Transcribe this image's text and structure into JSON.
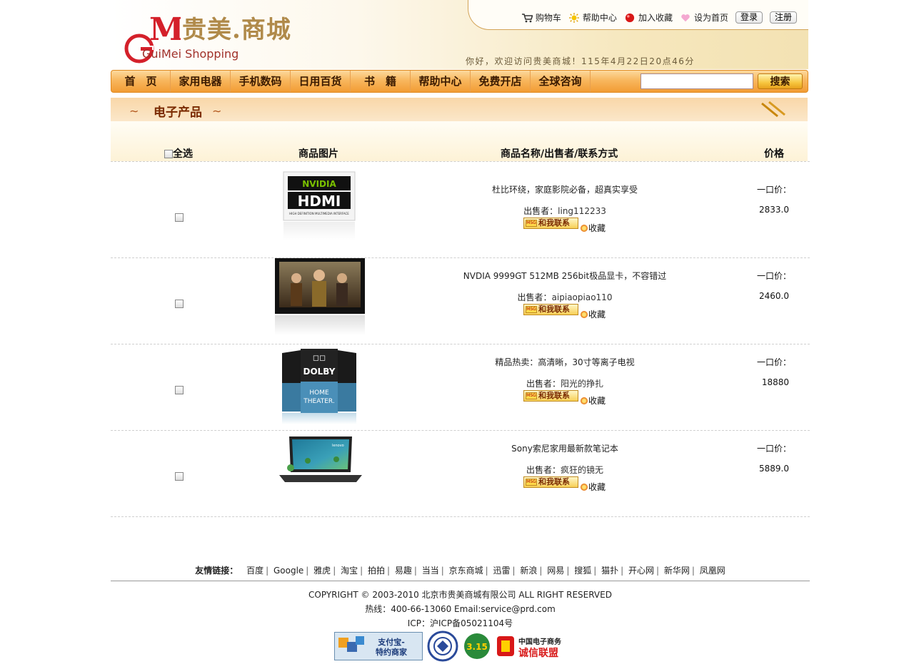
{
  "header": {
    "logo_text_cn": "贵美.商城",
    "logo_text_en": "GuiMei Shopping",
    "logo_letters": "GM",
    "greeting": "你好，欢迎访问贵美商城！115年4月22日20点46分",
    "links": {
      "cart": "购物车",
      "help": "帮助中心",
      "favorite": "加入收藏",
      "homepage": "设为首页",
      "login": "登录",
      "register": "注册"
    }
  },
  "nav": {
    "items": [
      "首　页",
      "家用电器",
      "手机数码",
      "日用百货",
      "书　籍",
      "帮助中心",
      "免费开店",
      "全球咨询"
    ],
    "search_placeholder": "",
    "search_label": "搜索"
  },
  "section": {
    "title": "电子产品",
    "columns": {
      "select_all": "全选",
      "image": "商品图片",
      "info": "商品名称/出售者/联系方式",
      "price": "价格"
    }
  },
  "products": [
    {
      "name": "杜比环绕，家庭影院必备，超真实享受",
      "seller_label": "出售者：",
      "seller": "ling112233",
      "contact": "和我联系",
      "fav": "收藏",
      "price_label": "一口价：",
      "price": "2833.0",
      "image_icon": "hdmi-logo"
    },
    {
      "name": "NVDIA 9999GT 512MB 256bit极品显卡，不容错过",
      "seller_label": "出售者：",
      "seller": "aipiaopiao110",
      "contact": "和我联系",
      "fav": "收藏",
      "price_label": "一口价：",
      "price": "2460.0",
      "image_icon": "tv-screen"
    },
    {
      "name": "精品热卖：高清晰，30寸等离子电视",
      "seller_label": "出售者：",
      "seller": "阳光的挣扎",
      "contact": "和我联系",
      "fav": "收藏",
      "price_label": "一口价：",
      "price": "18880",
      "image_icon": "dolby-home-theater"
    },
    {
      "name": "Sony索尼家用最新款笔记本",
      "seller_label": "出售者：",
      "seller": "疯狂的镜无",
      "contact": "和我联系",
      "fav": "收藏",
      "price_label": "一口价：",
      "price": "5889.0",
      "image_icon": "laptop"
    }
  ],
  "image_text": {
    "nvidia": "NVIDIA",
    "hdmi": "HDMI",
    "hdmi_sub": "HIGH DEFINITION MULTIMEDIA INTERFACE",
    "dolby": "DOLBY",
    "dolby_home": "HOME",
    "dolby_theater": "THEATER.",
    "lenovo": "lenovo",
    "msg_badge": "MSG"
  },
  "footer": {
    "friends_label": "友情链接：",
    "friends": [
      "百度",
      "Google",
      "雅虎",
      "淘宝",
      "拍拍",
      "易趣",
      "当当",
      "京东商城",
      "迅雷",
      "新浪",
      "网易",
      "搜狐",
      "猫扑",
      "开心网",
      "新华网",
      "凤凰网"
    ],
    "copyright": "COPYRIGHT © 2003-2010 北京市贵美商城有限公司 ALL RIGHT RESERVED",
    "hotline": "热线：400-66-13060 Email:service@prd.com",
    "icp": "ICP：沪ICP备05021104号",
    "badge_alipay_1": "支付宝-",
    "badge_alipay_2": "特约商家",
    "badge_315": "3.15",
    "badge_union_1": "中国电子商务",
    "badge_union_2": "诚信联盟"
  },
  "colors": {
    "nav_orange": "#f29c34",
    "accent_brown": "#7a2a00",
    "logo_gold": "#b08a4a",
    "logo_red": "#d4202a"
  }
}
